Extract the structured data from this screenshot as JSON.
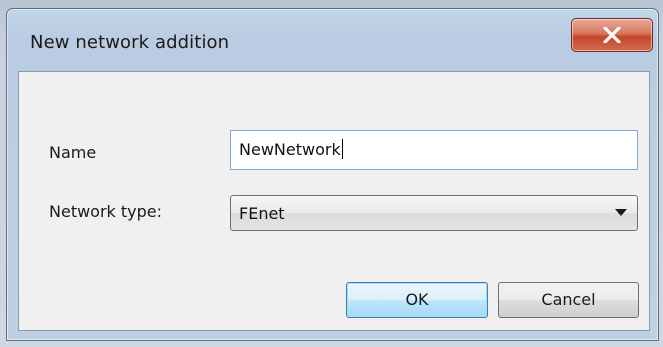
{
  "dialog": {
    "title": "New network addition",
    "close_label": "close"
  },
  "form": {
    "name_label": "Name",
    "name_value": "NewNetwork",
    "type_label": "Network type:",
    "type_value": "FEnet"
  },
  "buttons": {
    "ok_label": "OK",
    "cancel_label": "Cancel"
  },
  "colors": {
    "close_button": "#c4472c",
    "ok_border": "#3c7fb1",
    "titlebar": "#bfd0e3"
  }
}
